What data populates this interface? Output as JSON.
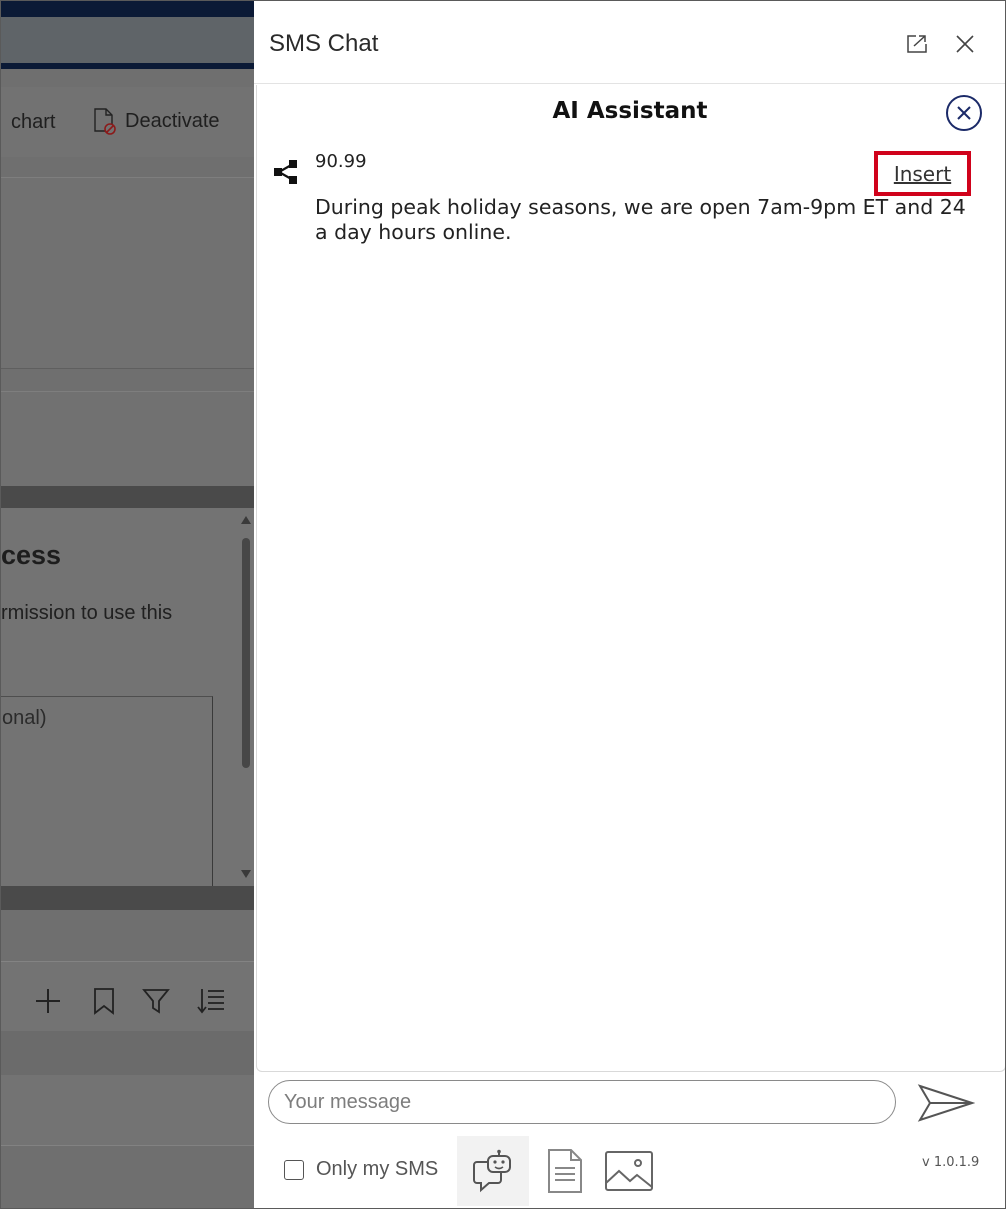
{
  "background": {
    "command_bar": {
      "chart_label": "chart",
      "deactivate_label": "Deactivate"
    },
    "dialog": {
      "title_fragment": "cess",
      "subtitle_fragment": "rmission to use this",
      "textarea_fragment": "onal)"
    }
  },
  "panel": {
    "title": "SMS Chat",
    "header_icons": [
      "popout-icon",
      "close-icon"
    ]
  },
  "ai_assistant": {
    "title": "AI Assistant",
    "close_icon": "circle-close-icon",
    "results": [
      {
        "score": "90.99",
        "icon": "share-nodes-icon",
        "insert_label": "Insert",
        "text": "During peak holiday seasons, we are open 7am-9pm ET and 24 a day hours online."
      }
    ]
  },
  "composer": {
    "placeholder": "Your message",
    "send_icon": "send-icon"
  },
  "footer": {
    "only_my_sms_label": "Only my SMS",
    "only_my_sms_checked": false,
    "tools": [
      "ai-assistant-icon",
      "template-document-icon",
      "image-icon"
    ],
    "version": "v 1.0.1.9"
  },
  "colors": {
    "highlight_border": "#d0021b",
    "ai_close_accent": "#1b2a68",
    "overlay": "#6f6f6f"
  }
}
